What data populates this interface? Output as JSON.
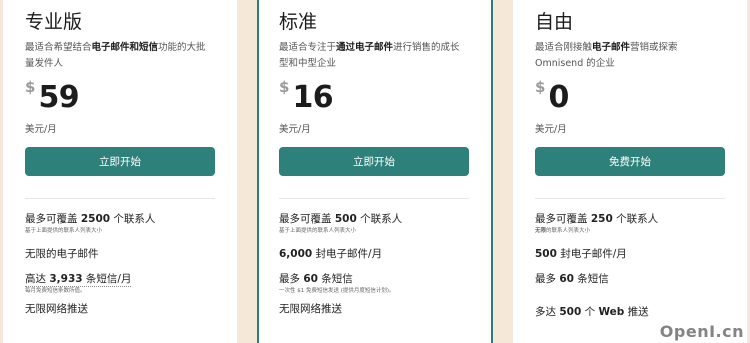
{
  "plans": [
    {
      "name": "专业版",
      "desc_pre": "最适合希望结合",
      "desc_bold": "电子邮件和短信",
      "desc_post": "功能的大批量发件人",
      "currency": "$",
      "price": "59",
      "period": "美元/月",
      "cta": "立即开始",
      "f1_pre": "最多可覆盖 ",
      "f1_bold": "2500",
      "f1_post": " 个联系人",
      "f1_sub": "基于上面提供的联系人列表大小",
      "f2": "无限的电子邮件",
      "f3_pre": "高达 ",
      "f3_bold": "3,933",
      "f3_post": " 条短信/月",
      "f3_sub": "每月免费短信条数所值。",
      "f4": "无限网络推送"
    },
    {
      "name": "标准",
      "desc_pre": "最适合专注于",
      "desc_bold": "通过电子邮件",
      "desc_post": "进行销售的成长型和中型企业",
      "currency": "$",
      "price": "16",
      "period": "美元/月",
      "cta": "立即开始",
      "f1_pre": "最多可覆盖 ",
      "f1_bold": "500",
      "f1_post": " 个联系人",
      "f1_sub": "基于上面提供的联系人列表大小",
      "f2_bold": "6,000",
      "f2_post": " 封电子邮件/月",
      "f3_pre": "最多 ",
      "f3_bold": "60",
      "f3_post": " 条短信",
      "f3_sub": "一次性 $1 免费短信发送 (提供月度短信计划)。",
      "f4": "无限网络推送"
    },
    {
      "name": "自由",
      "desc_pre": "最适合刚接触",
      "desc_bold": "电子邮件",
      "desc_post": "营销或探索 Omnisend 的企业",
      "currency": "$",
      "price": "0",
      "period": "美元/月",
      "cta": "免费开始",
      "f1_pre": "最多可覆盖 ",
      "f1_bold": "250",
      "f1_post": " 个联系人",
      "f1_sub_bold": "无限",
      "f1_sub": "的联系人列表大小",
      "f2_bold": "500",
      "f2_post": " 封电子邮件/月",
      "f3_pre": "最多 ",
      "f3_bold": "60",
      "f3_post": " 条短信",
      "f4_pre": "多达 ",
      "f4_bold": "500",
      "f4_mid": " 个 ",
      "f4_bold2": "Web",
      "f4_post": " 推送"
    }
  ],
  "watermark": {
    "sym": "",
    "text": "OpenI.cn"
  },
  "colors": {
    "background": "#f5e8d9",
    "accent": "#2e807b",
    "card": "#ffffff"
  }
}
